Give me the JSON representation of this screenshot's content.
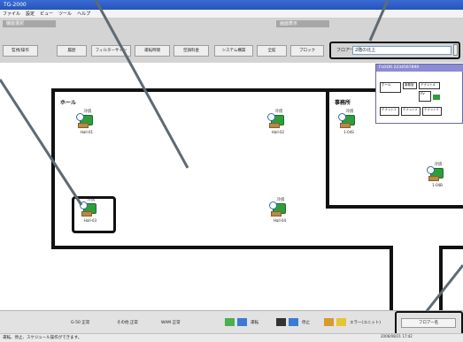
{
  "window": {
    "title": "TG-2000"
  },
  "menu": [
    "ファイル",
    "設定",
    "ビュー",
    "ツール",
    "ヘルプ"
  ],
  "sections": {
    "function": "機能選択",
    "display": "画面表示"
  },
  "toolbar": {
    "buttons": [
      "監視/操作",
      "履歴",
      "フィルターサイン",
      "運転時間",
      "空調料金",
      "システム構築",
      "全館",
      "ブロック"
    ]
  },
  "floor": {
    "label": "フロアー",
    "value": "2階の北上"
  },
  "zones": {
    "hall": "ホール",
    "office": "事務所"
  },
  "units": [
    {
      "name": "Hall-01",
      "status": "冷房"
    },
    {
      "name": "Hall-02",
      "status": "冷房"
    },
    {
      "name": "1-04S",
      "status": "冷房"
    },
    {
      "name": "1-04B",
      "status": "冷房"
    },
    {
      "name": "Hall-03",
      "status": "冷房"
    },
    {
      "name": "Hall-04",
      "status": "冷房"
    }
  ],
  "minimap": {
    "title": "FLOOR 2234567890",
    "rooms": [
      "ホール",
      "事務室",
      "テナント4",
      "EV",
      "テナント1",
      "テナント2",
      "テナント3"
    ]
  },
  "legend": {
    "items": [
      "G-50 正常",
      "その他 正常",
      "WAM 正常",
      "運転",
      "停止",
      "エラー(ユニット)"
    ]
  },
  "floor_list_button": "フロアー名",
  "message": "運転、停止、スケジュール操作ができます。",
  "datetime": "2006/08/21 17:42",
  "colors": {
    "titlebar": "#2e5fc9",
    "unit_green": "#2e9e3a",
    "section_gray": "#a7a7a7"
  }
}
